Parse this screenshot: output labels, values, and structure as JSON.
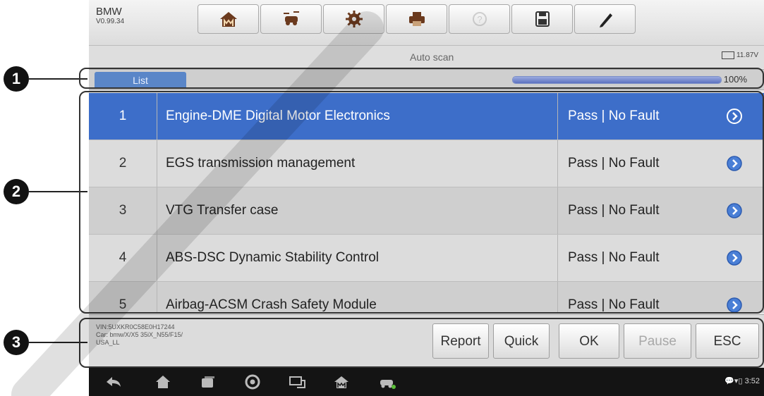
{
  "vehicle": {
    "make": "BMW",
    "version": "V0.99.34"
  },
  "toolbar": {
    "tools": [
      {
        "name": "home-icon",
        "enabled": true
      },
      {
        "name": "vehicle-swap-icon",
        "enabled": true
      },
      {
        "name": "settings-icon",
        "enabled": true
      },
      {
        "name": "print-icon",
        "enabled": true
      },
      {
        "name": "help-icon",
        "enabled": false
      },
      {
        "name": "save-icon",
        "enabled": true
      },
      {
        "name": "pen-icon",
        "enabled": true
      }
    ]
  },
  "status": {
    "title": "Auto scan",
    "battery_voltage": "11.87V"
  },
  "list_tab": {
    "label": "List",
    "progress_percent": 100,
    "progress_text": "100%"
  },
  "systems": [
    {
      "num": "1",
      "name": "Engine-DME Digital Motor Electronics",
      "status": "Pass | No Fault",
      "selected": true
    },
    {
      "num": "2",
      "name": "EGS transmission management",
      "status": "Pass | No Fault",
      "selected": false
    },
    {
      "num": "3",
      "name": "VTG Transfer case",
      "status": "Pass | No Fault",
      "selected": false
    },
    {
      "num": "4",
      "name": "ABS-DSC Dynamic Stability Control",
      "status": "Pass | No Fault",
      "selected": false
    },
    {
      "num": "5",
      "name": "Airbag-ACSM Crash Safety Module",
      "status": "Pass | No Fault",
      "selected": false
    }
  ],
  "vehicle_info": {
    "vin": "VIN:5UXKR0C58E0H17244",
    "car": "Car: bmw/X/X5 35iX_N55/F15/",
    "region": "USA_LL"
  },
  "actions": {
    "report": "Report",
    "quick": "Quick",
    "ok": "OK",
    "pause": "Pause",
    "esc": "ESC"
  },
  "system_bar": {
    "time": "3:52"
  },
  "callouts": {
    "c1": "1",
    "c2": "2",
    "c3": "3"
  },
  "colors": {
    "selected_row": "#3d6ec9",
    "list_tab": "#5a86c8",
    "navbar": "#141414"
  }
}
